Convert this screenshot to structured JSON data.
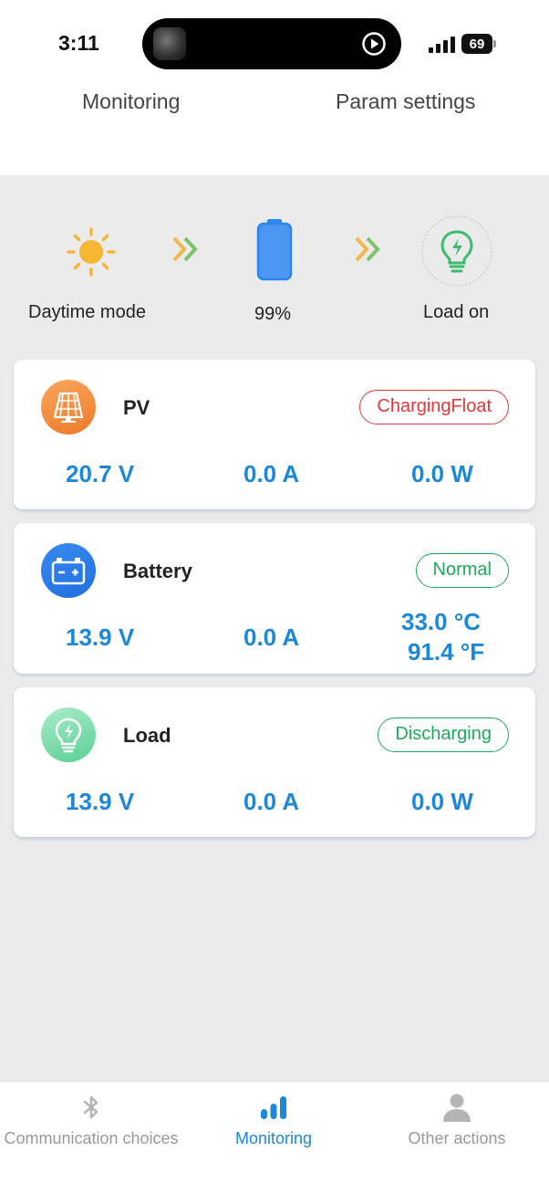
{
  "status_bar": {
    "time": "3:11",
    "battery_level": "69"
  },
  "top_tabs": {
    "monitoring": "Monitoring",
    "param_settings": "Param settings"
  },
  "flow": {
    "mode_label": "Daytime mode",
    "battery_soc": "99%",
    "load_label": "Load on",
    "icons": [
      "sun-icon",
      "double-chevron-icon",
      "battery-icon",
      "double-chevron-icon",
      "lightbulb-icon"
    ]
  },
  "cards": {
    "pv": {
      "title": "PV",
      "status": "ChargingFloat",
      "voltage": "20.7 V",
      "current": "0.0 A",
      "power": "0.0 W"
    },
    "battery": {
      "title": "Battery",
      "status": "Normal",
      "voltage": "13.9 V",
      "current": "0.0 A",
      "temp_c": "33.0 °C",
      "temp_f": "91.4 °F"
    },
    "load": {
      "title": "Load",
      "status": "Discharging",
      "voltage": "13.9 V",
      "current": "0.0 A",
      "power": "0.0 W"
    }
  },
  "bottom_nav": {
    "items": [
      {
        "label": "Communication choices",
        "icon": "bluetooth-icon",
        "active": false
      },
      {
        "label": "Monitoring",
        "icon": "bar-chart-icon",
        "active": true
      },
      {
        "label": "Other actions",
        "icon": "person-icon",
        "active": false
      }
    ]
  },
  "colors": {
    "accent_blue": "#1e88d8",
    "status_red": "#e03a3a",
    "status_green": "#1faa5a",
    "sun_orange": "#f5b43a",
    "background": "#ebebeb"
  }
}
